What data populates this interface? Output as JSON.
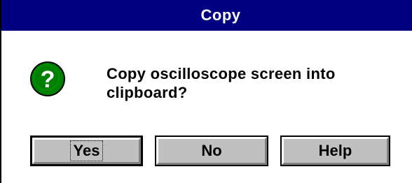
{
  "dialog": {
    "title": "Copy",
    "message": "Copy oscilloscope screen into\nclipboard?",
    "icon": "question-icon",
    "buttons": {
      "yes": "Yes",
      "no": "No",
      "help": "Help"
    }
  },
  "colors": {
    "titlebar": "#000080",
    "button_face": "#c0c0c0",
    "icon_green": "#008000"
  }
}
